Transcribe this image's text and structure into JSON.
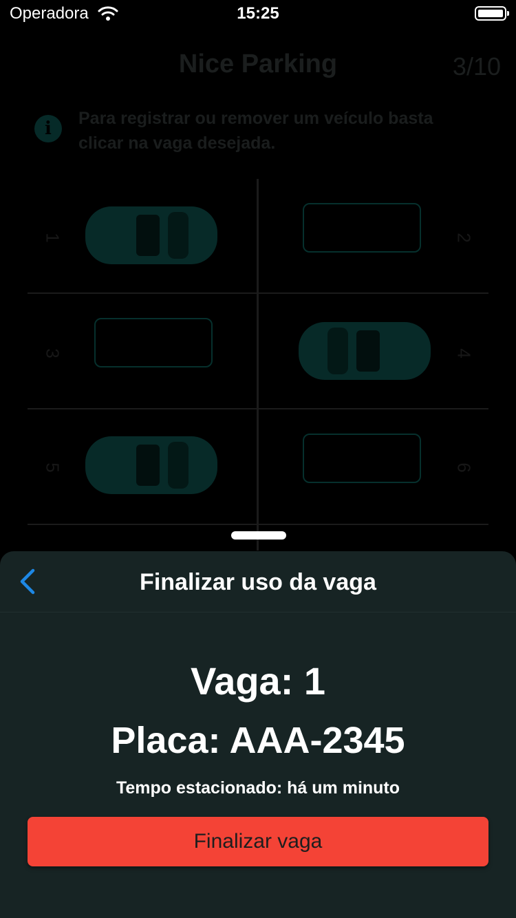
{
  "status_bar": {
    "carrier": "Operadora",
    "time": "15:25"
  },
  "background": {
    "title": "Nice Parking",
    "count": "3/10",
    "info_text": "Para registrar ou remover um veículo basta clicar na vaga desejada.",
    "slots": [
      {
        "number": "1",
        "occupied": true
      },
      {
        "number": "2",
        "occupied": false
      },
      {
        "number": "3",
        "occupied": false
      },
      {
        "number": "4",
        "occupied": true
      },
      {
        "number": "5",
        "occupied": true
      },
      {
        "number": "6",
        "occupied": false
      }
    ]
  },
  "sheet": {
    "title": "Finalizar uso da vaga",
    "vaga": "Vaga: 1",
    "placa": "Placa: AAA-2345",
    "tempo": "Tempo estacionado: há um minuto",
    "button_label": "Finalizar vaga"
  },
  "colors": {
    "accent": "#1e88e5",
    "danger": "#f44336",
    "sheet_bg": "#172424",
    "slot_border": "#06302d"
  },
  "icons": {
    "back": "chevron-left-icon",
    "info": "info-icon",
    "wifi": "wifi-icon",
    "battery": "battery-icon"
  }
}
